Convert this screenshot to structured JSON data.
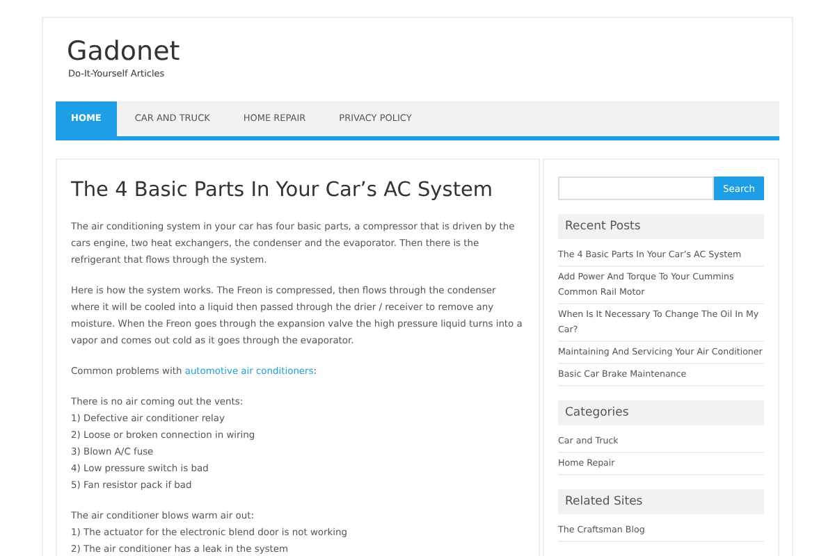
{
  "site": {
    "title": "Gadonet",
    "tagline": "Do-It-Yourself Articles"
  },
  "nav": [
    {
      "label": "HOME",
      "selected": true
    },
    {
      "label": "CAR AND TRUCK",
      "selected": false
    },
    {
      "label": "HOME REPAIR",
      "selected": false
    },
    {
      "label": "PRIVACY POLICY",
      "selected": false
    }
  ],
  "article": {
    "title": "The 4 Basic Parts In Your Car’s AC System",
    "blocks": [
      {
        "kind": "paragraph",
        "text": "The air conditioning system in your car has four basic parts, a compressor that is driven by the cars engine, two heat exchangers, the condenser and the evaporator. Then there is the refrigerant that flows through the system."
      },
      {
        "kind": "paragraph",
        "text": "Here is how the system works. The Freon is compressed, then flows through the condenser where it will be cooled into a liquid then passed through the drier / receiver to remove any moisture. When the Freon goes through the expansion valve the high pressure liquid turns into a vapor and comes out cold as it goes through the evaporator."
      },
      {
        "kind": "link_paragraph",
        "text": "Common problems with ",
        "link": "automotive air conditioners",
        "after": ":"
      },
      {
        "kind": "list",
        "lines": [
          "There is no air coming out the vents:",
          "1) Defective air conditioner relay",
          "2) Loose or broken connection in wiring",
          "3) Blown A/C fuse",
          "4) Low pressure switch is bad",
          "5) Fan resistor pack if bad"
        ]
      },
      {
        "kind": "list",
        "lines": [
          "The air conditioner blows warm air out:",
          "1) The actuator for the electronic blend door is not working",
          "2) The air conditioner has a leak in the system"
        ]
      }
    ]
  },
  "sidebar": {
    "search_button": "Search",
    "widgets": [
      {
        "title": "Recent Posts",
        "links": [
          "The 4 Basic Parts In Your Car’s AC System",
          "Add Power And Torque To Your Cummins Common Rail Motor",
          "When Is It Necessary To Change The Oil In My Car?",
          "Maintaining And Servicing Your Air Conditioner",
          "Basic Car Brake Maintenance"
        ]
      },
      {
        "title": "Categories",
        "links": [
          "Car and Truck",
          "Home Repair"
        ]
      },
      {
        "title": "Related Sites",
        "links": [
          "The Craftsman Blog"
        ]
      }
    ]
  }
}
